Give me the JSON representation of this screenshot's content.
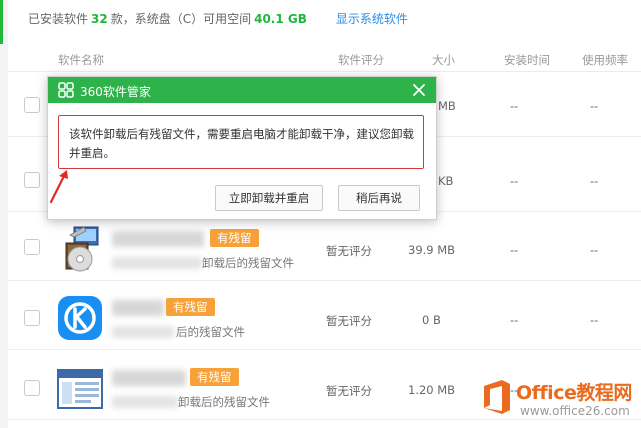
{
  "summary": {
    "prefix": "已安装软件",
    "count": "32",
    "mid": "款，系统盘（C）可用空间",
    "space": "40.1 GB",
    "show_system_link": "显示系统软件"
  },
  "table": {
    "headers": {
      "name": "软件名称",
      "rating": "软件评分",
      "size": "大小",
      "install_time": "安装时间",
      "frequency": "使用频率"
    },
    "rows": [
      {
        "size": "MB",
        "install_time": "--",
        "frequency": "--"
      },
      {
        "size": "KB",
        "install_time": "--",
        "frequency": "--"
      },
      {
        "badge": "有残留",
        "subtext": "卸载后的残留文件",
        "rating": "暂无评分",
        "size": "39.9 MB",
        "install_time": "--",
        "frequency": "--"
      },
      {
        "badge": "有残留",
        "subtext": "后的残留文件",
        "rating": "暂无评分",
        "size": "0 B",
        "install_time": "--",
        "frequency": "--"
      },
      {
        "badge": "有残留",
        "subtext": "卸载后的残留文件",
        "rating": "暂无评分",
        "size": "1.20 MB",
        "install_time": "--",
        "frequency": "--"
      }
    ]
  },
  "dialog": {
    "title": "360软件管家",
    "message": "该软件卸载后有残留文件，需要重启电脑才能卸载干净，建议您卸载并重启。",
    "primary_button": "立即卸载并重启",
    "secondary_button": "稍后再说"
  },
  "watermark": {
    "title": "Office教程网",
    "url": "www.office26.com"
  },
  "colors": {
    "accent_green": "#1fb83d",
    "dialog_header": "#2db34a",
    "badge_orange": "#f6a13a",
    "link_blue": "#2a8ee6",
    "highlight_red": "#d23a3a",
    "watermark_orange": "#ea6b1f"
  },
  "icons": [
    "app-logo-icon",
    "close-icon",
    "installer-icon",
    "kugou-icon",
    "window-app-icon",
    "office-logo-icon",
    "annotation-arrow-icon"
  ]
}
